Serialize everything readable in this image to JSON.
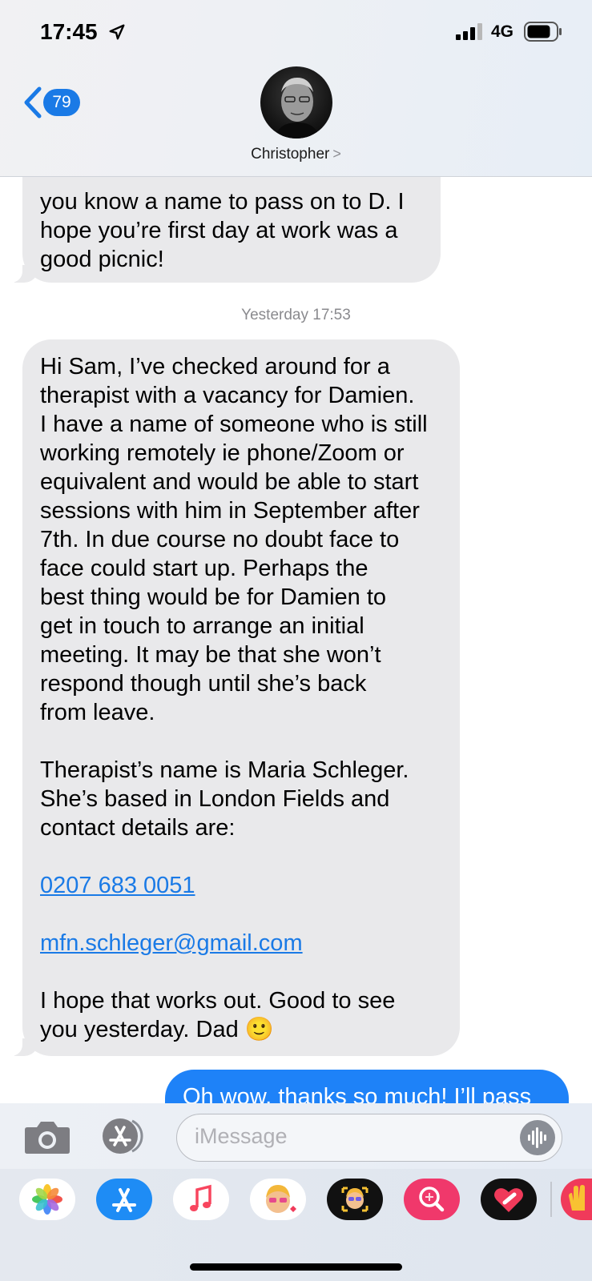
{
  "status_bar": {
    "time": "17:45",
    "network": "4G"
  },
  "header": {
    "back_count": "79",
    "contact_name": "Christopher",
    "contact_chevron": ">"
  },
  "messages": {
    "first_incoming": {
      "lines": [
        "you know a name to pass on to D. I",
        "hope you’re first day at work was a",
        "good picnic!"
      ]
    },
    "timestamp": "Yesterday 17:53",
    "second_incoming": {
      "para1": [
        "Hi Sam, I’ve checked around for a",
        "therapist with a vacancy for Damien.",
        "I have a name of someone who is still",
        "working remotely ie phone/Zoom or",
        "equivalent and would be able to start",
        "sessions with him in September after",
        "7th.  In due course no doubt face to",
        "face could start up.  Perhaps the",
        "best thing would be for Damien to",
        "get in touch to arrange an initial",
        "meeting. It may be that she won’t",
        "respond though until she’s back",
        "from leave."
      ],
      "para2": [
        "Therapist’s name is Maria Schleger.",
        "She’s based in London Fields and",
        "contact details are:"
      ],
      "phone": "0207 683 0051",
      "email": "mfn.schleger@gmail.com",
      "closing": [
        "I hope that works out. Good to see",
        "you yesterday. Dad 🙂"
      ]
    },
    "outgoing": {
      "text": "Oh wow, thanks so much! I’ll pass"
    }
  },
  "input_bar": {
    "placeholder": "iMessage"
  },
  "app_tray": {
    "apps": [
      "photos-app",
      "app-store-app",
      "music-app",
      "memoji-app",
      "animoji-app",
      "image-search-app",
      "digital-touch-app",
      "hand-app"
    ]
  },
  "colors": {
    "accent": "#1a7ae6",
    "incoming_bubble": "#e9e9eb",
    "outgoing_bubble": "#1e82f8"
  }
}
